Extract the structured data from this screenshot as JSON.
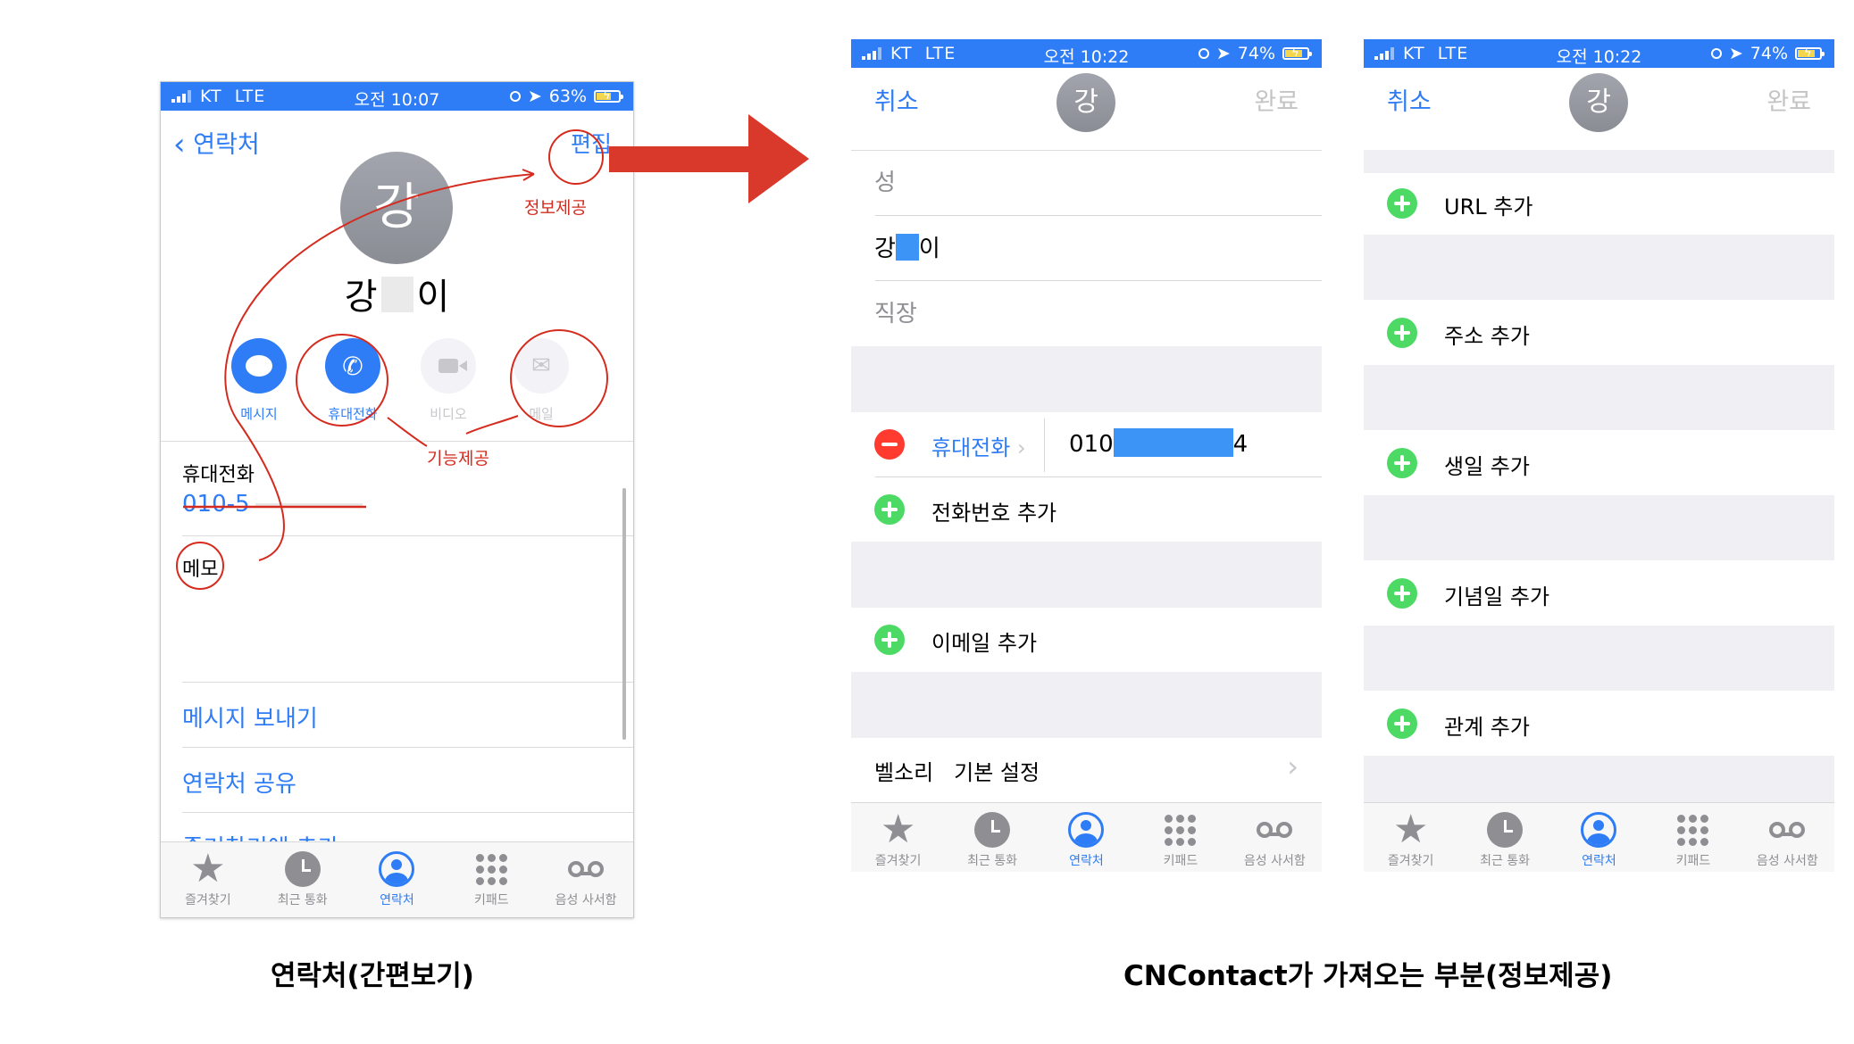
{
  "status_bar_1": {
    "carrier": "KT",
    "network": "LTE",
    "time": "오전 10:07",
    "battery": "63%"
  },
  "status_bar_2": {
    "carrier": "KT",
    "network": "LTE",
    "time": "오전 10:22",
    "battery": "74%"
  },
  "contact_view": {
    "back_label": "연락처",
    "edit_label": "편집",
    "avatar_initial": "강",
    "name_first": "강",
    "name_last": "이",
    "actions": [
      {
        "label": "메시지",
        "icon": "message-icon",
        "enabled": true
      },
      {
        "label": "휴대전화",
        "icon": "phone-icon",
        "enabled": true
      },
      {
        "label": "비디오",
        "icon": "video-icon",
        "enabled": false
      },
      {
        "label": "메일",
        "icon": "mail-icon",
        "enabled": false
      }
    ],
    "phone_label": "휴대전화",
    "phone_value": "010-5",
    "memo_label": "메모",
    "send_message": "메시지 보내기",
    "share_contact": "연락처 공유",
    "add_favorite": "즐겨찾기에 추가"
  },
  "annotations": {
    "info": "정보제공",
    "function": "기능제공"
  },
  "edit_view_1": {
    "cancel": "취소",
    "done": "완료",
    "avatar_initial": "강",
    "last_name_placeholder": "성",
    "first_name_prefix": "강",
    "first_name_suffix": "이",
    "company_placeholder": "직장",
    "phone_label": "휴대전화",
    "phone_prefix": "010",
    "phone_suffix": "4",
    "add_phone": "전화번호 추가",
    "add_email": "이메일 추가",
    "ringtone_label": "벨소리",
    "ringtone_value": "기본 설정"
  },
  "edit_view_2": {
    "cancel": "취소",
    "done": "완료",
    "avatar_initial": "강",
    "add_items": [
      "URL 추가",
      "주소 추가",
      "생일 추가",
      "기념일 추가",
      "관계 추가"
    ]
  },
  "tabs": [
    "즐겨찾기",
    "최근 통화",
    "연락처",
    "키패드",
    "음성 사서함"
  ],
  "active_tab": "연락처",
  "captions": {
    "left": "연락처(간편보기)",
    "right": "CNContact가 가져오는 부분(정보제공)"
  },
  "colors": {
    "accent": "#2e7cf6",
    "annotation": "#d52b1e",
    "plus": "#4cd964",
    "minus": "#ff3b30"
  }
}
